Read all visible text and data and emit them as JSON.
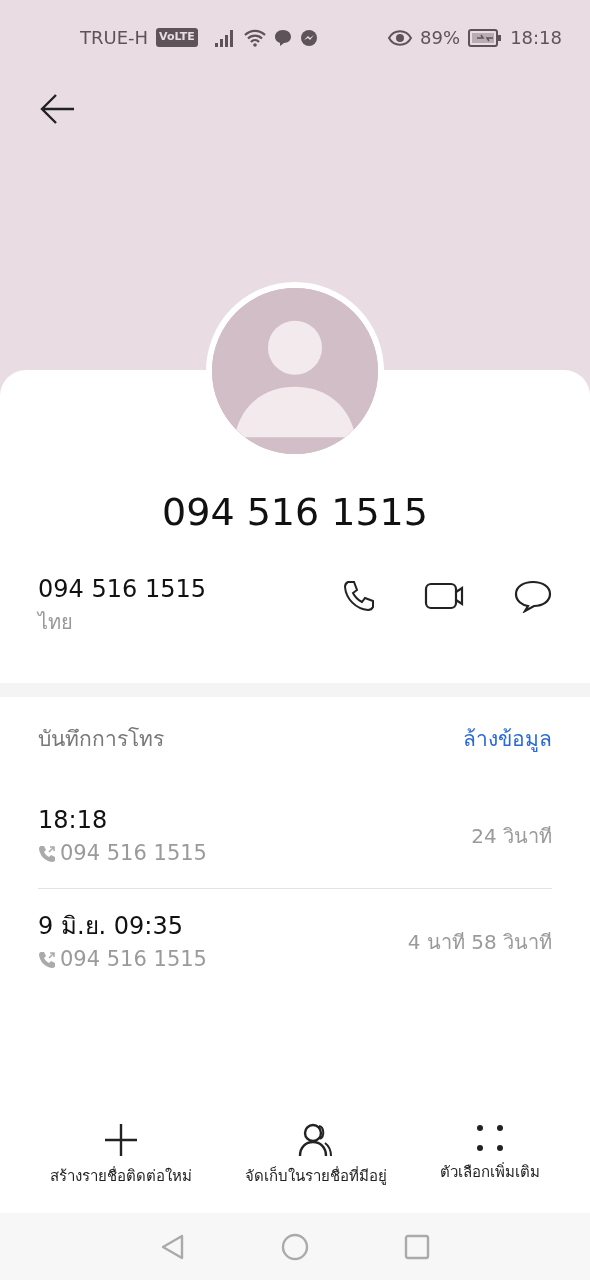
{
  "status_bar": {
    "carrier": "TRUE-H",
    "volte": "VoLTE",
    "battery": "89%",
    "time": "18:18"
  },
  "contact": {
    "name": "094 516 1515",
    "number": "094 516 1515",
    "region": "ไทย"
  },
  "call_log": {
    "title": "บันทึกการโทร",
    "clear": "ล้างข้อมูล",
    "entries": [
      {
        "time": "18:18",
        "number": "094 516 1515",
        "duration": "24 วินาที"
      },
      {
        "time": "9 มิ.ย. 09:35",
        "number": "094 516 1515",
        "duration": "4 นาที 58 วินาที"
      }
    ]
  },
  "actions": [
    {
      "kind": "add",
      "label": "สร้างรายชื่อติดต่อใหม่"
    },
    {
      "kind": "save",
      "label": "จัดเก็บในรายชื่อที่มีอยู่"
    },
    {
      "kind": "more",
      "label": "ตัวเลือกเพิ่มเติม"
    }
  ]
}
